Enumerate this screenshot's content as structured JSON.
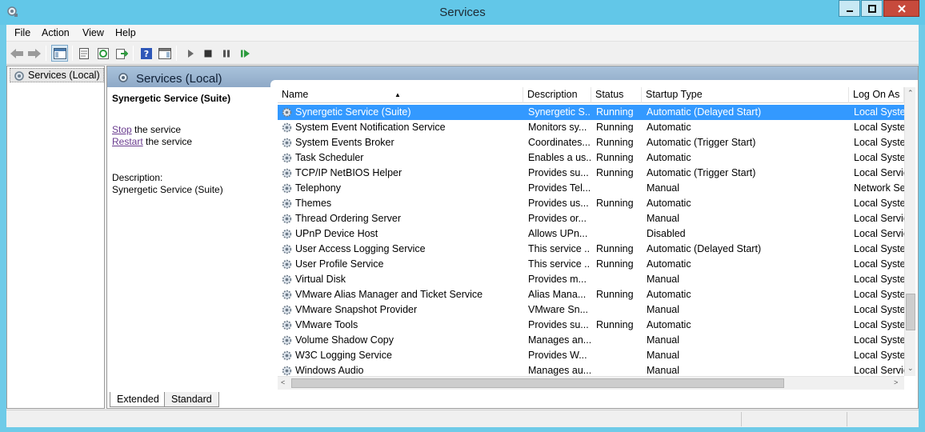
{
  "window": {
    "title": "Services",
    "controls": {
      "minimize": "minimize",
      "maximize": "maximize",
      "close": "close"
    }
  },
  "menu": [
    "File",
    "Action",
    "View",
    "Help"
  ],
  "toolbar": {
    "icons": [
      "back-icon",
      "forward-icon",
      "show-hide-console-tree-icon",
      "properties-icon",
      "refresh-icon",
      "export-list-icon",
      "help-icon",
      "show-action-pane-icon",
      "start-service-icon",
      "stop-service-icon",
      "pause-service-icon",
      "resume-service-icon"
    ]
  },
  "tree": {
    "item": "Services (Local)"
  },
  "header": {
    "title": "Services (Local)"
  },
  "description": {
    "title": "Synergetic Service (Suite)",
    "stop_link": "Stop",
    "stop_rest": " the service",
    "restart_link": "Restart",
    "restart_rest": " the service",
    "label": "Description:",
    "text": "Synergetic Service (Suite)"
  },
  "columns": [
    "Name",
    "Description",
    "Status",
    "Startup Type",
    "Log On As"
  ],
  "rows": [
    {
      "name": "Synergetic Service (Suite)",
      "description": "Synergetic S...",
      "status": "Running",
      "startup": "Automatic (Delayed Start)",
      "logon": "Local System"
    },
    {
      "name": "System Event Notification Service",
      "description": "Monitors sy...",
      "status": "Running",
      "startup": "Automatic",
      "logon": "Local System"
    },
    {
      "name": "System Events Broker",
      "description": "Coordinates...",
      "status": "Running",
      "startup": "Automatic (Trigger Start)",
      "logon": "Local System"
    },
    {
      "name": "Task Scheduler",
      "description": "Enables a us...",
      "status": "Running",
      "startup": "Automatic",
      "logon": "Local System"
    },
    {
      "name": "TCP/IP NetBIOS Helper",
      "description": "Provides su...",
      "status": "Running",
      "startup": "Automatic (Trigger Start)",
      "logon": "Local Service"
    },
    {
      "name": "Telephony",
      "description": "Provides Tel...",
      "status": "",
      "startup": "Manual",
      "logon": "Network Service"
    },
    {
      "name": "Themes",
      "description": "Provides us...",
      "status": "Running",
      "startup": "Automatic",
      "logon": "Local System"
    },
    {
      "name": "Thread Ordering Server",
      "description": "Provides or...",
      "status": "",
      "startup": "Manual",
      "logon": "Local Service"
    },
    {
      "name": "UPnP Device Host",
      "description": "Allows UPn...",
      "status": "",
      "startup": "Disabled",
      "logon": "Local Service"
    },
    {
      "name": "User Access Logging Service",
      "description": "This service ...",
      "status": "Running",
      "startup": "Automatic (Delayed Start)",
      "logon": "Local System"
    },
    {
      "name": "User Profile Service",
      "description": "This service ...",
      "status": "Running",
      "startup": "Automatic",
      "logon": "Local System"
    },
    {
      "name": "Virtual Disk",
      "description": "Provides m...",
      "status": "",
      "startup": "Manual",
      "logon": "Local System"
    },
    {
      "name": "VMware Alias Manager and Ticket Service",
      "description": "Alias Mana...",
      "status": "Running",
      "startup": "Automatic",
      "logon": "Local System"
    },
    {
      "name": "VMware Snapshot Provider",
      "description": "VMware Sn...",
      "status": "",
      "startup": "Manual",
      "logon": "Local System"
    },
    {
      "name": "VMware Tools",
      "description": "Provides su...",
      "status": "Running",
      "startup": "Automatic",
      "logon": "Local System"
    },
    {
      "name": "Volume Shadow Copy",
      "description": "Manages an...",
      "status": "",
      "startup": "Manual",
      "logon": "Local System"
    },
    {
      "name": "W3C Logging Service",
      "description": "Provides W...",
      "status": "",
      "startup": "Manual",
      "logon": "Local System"
    },
    {
      "name": "Windows Audio",
      "description": "Manages au...",
      "status": "",
      "startup": "Manual",
      "logon": "Local Service"
    }
  ],
  "selected_row": 0,
  "tabs": [
    "Extended",
    "Standard"
  ],
  "active_tab": "Extended",
  "colors": {
    "titlebar": "#62c7e8",
    "selection": "#3399ff",
    "header_band": "#9fb8d3",
    "link": "#6a3c8f"
  }
}
